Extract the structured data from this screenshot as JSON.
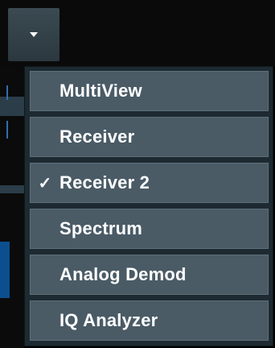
{
  "toolbar": {
    "dropdown_icon": "chevron-down-icon"
  },
  "menu": {
    "items": [
      {
        "label": "MultiView",
        "checked": false
      },
      {
        "label": "Receiver",
        "checked": false
      },
      {
        "label": "Receiver 2",
        "checked": true,
        "check_mark": "✓"
      },
      {
        "label": "Spectrum",
        "checked": false
      },
      {
        "label": "Analog Demod",
        "checked": false
      },
      {
        "label": "IQ Analyzer",
        "checked": false
      }
    ]
  },
  "colors": {
    "menu_background": "#1e2a31",
    "item_background": "#4a5b66",
    "item_text": "#ffffff"
  }
}
